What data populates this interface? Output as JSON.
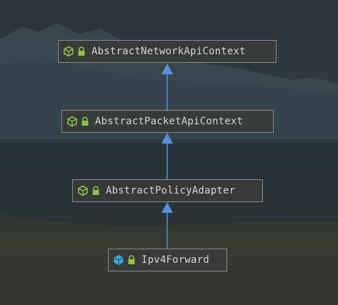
{
  "diagram": {
    "nodes": [
      {
        "id": "n1",
        "label": "AbstractNetworkApiContext",
        "icon": "abstract-class-icon",
        "visibility": "lock-icon"
      },
      {
        "id": "n2",
        "label": "AbstractPacketApiContext",
        "icon": "abstract-class-icon",
        "visibility": "lock-icon"
      },
      {
        "id": "n3",
        "label": "AbstractPolicyAdapter",
        "icon": "abstract-class-icon",
        "visibility": "lock-icon"
      },
      {
        "id": "n4",
        "label": "Ipv4Forward",
        "icon": "class-icon",
        "visibility": "lock-icon"
      }
    ],
    "edges": [
      {
        "from": "n2",
        "to": "n1",
        "type": "inherits"
      },
      {
        "from": "n3",
        "to": "n2",
        "type": "inherits"
      },
      {
        "from": "n4",
        "to": "n3",
        "type": "inherits"
      }
    ]
  },
  "colors": {
    "edge": "#5b8fd9",
    "abstract_icon": "#8bc34a",
    "class_icon": "#3ea8d6",
    "lock": "#8bc34a"
  }
}
